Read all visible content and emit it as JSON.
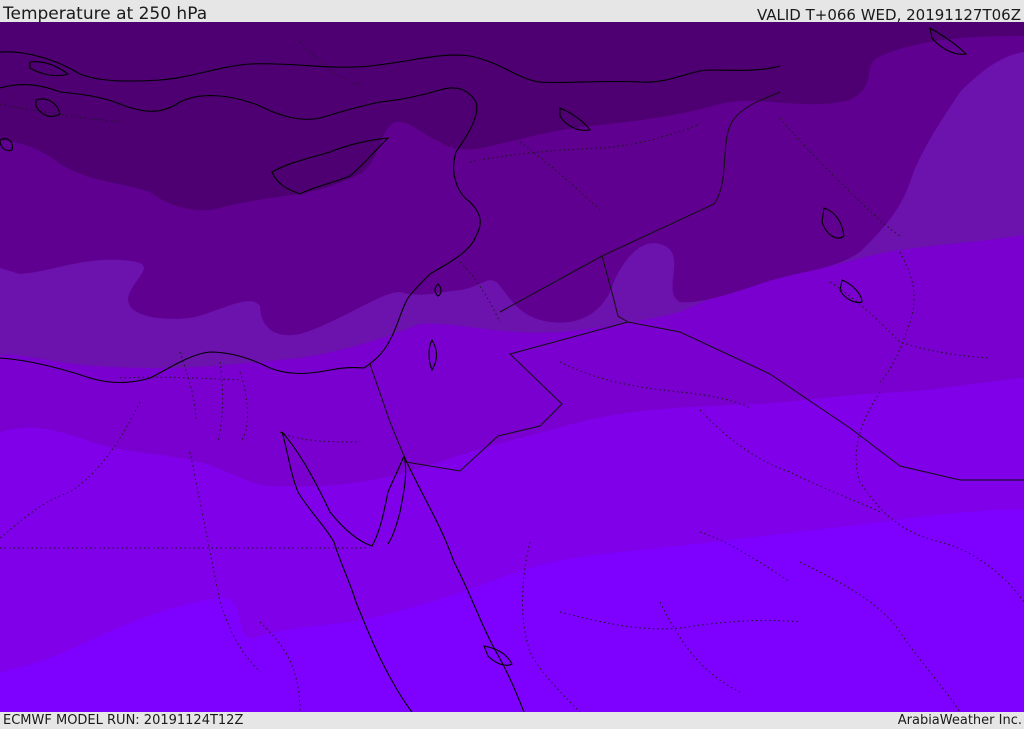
{
  "header": {
    "title": "Temperature at 250 hPa",
    "valid": "VALID T+066 WED, 20191127T06Z"
  },
  "footer": {
    "model_run": "ECMWF MODEL RUN: 20191124T12Z",
    "credit": "ArabiaWeather Inc."
  },
  "map": {
    "field_colors": {
      "coldest": "#4e0072",
      "colder": "#5f0090",
      "cold": "#6c12ad",
      "mid": "#7a00cf",
      "warm": "#7f00e9",
      "warmest": "#7e00fe"
    },
    "coastline_color": "#000000",
    "border_style": "dotted",
    "region": "Eastern Mediterranean, Egypt, Levant, Arabian Peninsula"
  }
}
